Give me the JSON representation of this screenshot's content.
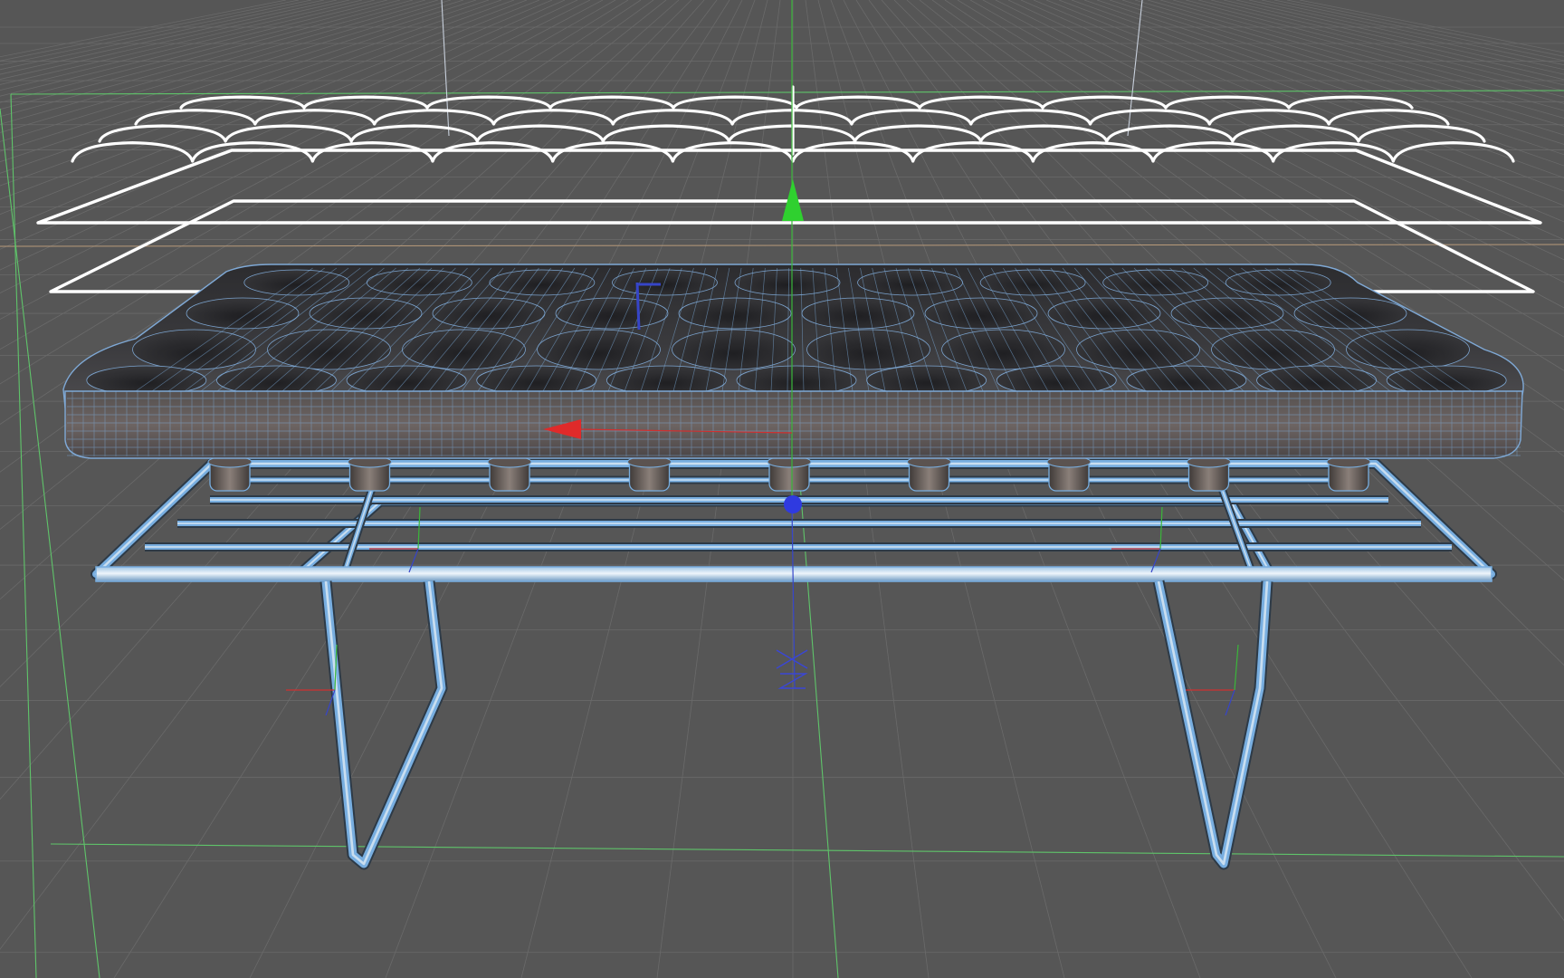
{
  "viewport": {
    "view": "perspective-3d",
    "background_color": "#565656",
    "grid_color": "#6a6a6a",
    "grid_major_color": "#727272",
    "camera_frustum_color": "#5fc46a",
    "spline_color": "#ffffff",
    "mesh_wire_color": "#78aee0",
    "mesh_fill_color": "#3b3b3e",
    "metal_highlight_color": "#d7e6f2"
  },
  "objects": [
    {
      "name": "cushion-tuft-splines",
      "kind": "spline"
    },
    {
      "name": "cushion-outline-splines",
      "kind": "spline"
    },
    {
      "name": "tufted-cushion",
      "kind": "polygon-mesh"
    },
    {
      "name": "cushion-feet",
      "kind": "polygon-mesh",
      "count": 9
    },
    {
      "name": "bench-frame",
      "kind": "polygon-mesh"
    }
  ],
  "gizmo": {
    "x_axis": {
      "label": "x-axis",
      "color": "#e02a2a"
    },
    "y_axis": {
      "label": "y-axis",
      "color": "#2fd02f"
    },
    "z_axis": {
      "label": "z-axis",
      "color": "#2f3ae0"
    }
  }
}
